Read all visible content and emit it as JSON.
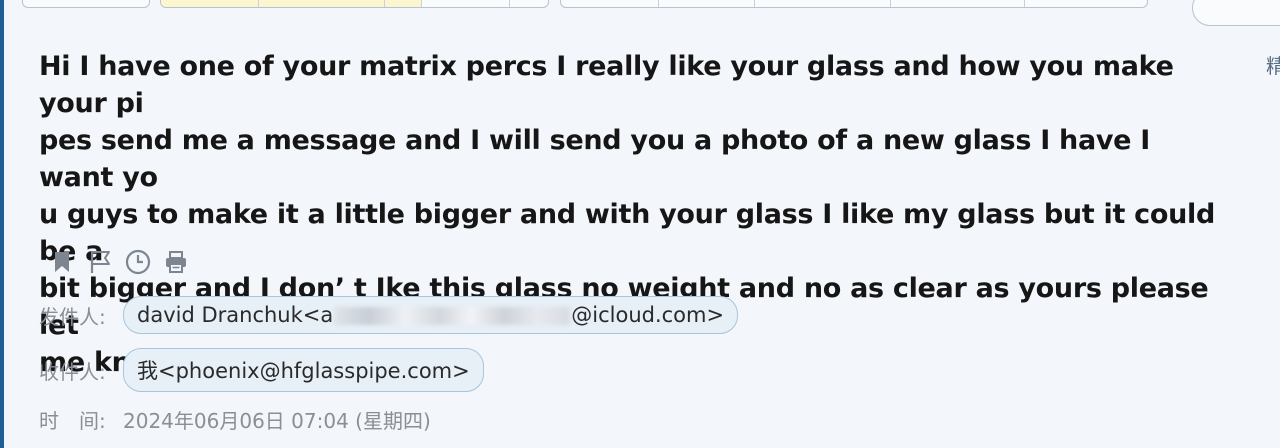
{
  "subject": "Hi I have one of your matrix percs I really like your glass and how you make your pi\npes send me a message and I will send you a photo of a new glass I have I want yo\nu guys to make it a little bigger and with your glass I like my glass but it could be a\nbit bigger and I don’ t Ike this glass no weight and no as clear as yours please let\nme know thank you",
  "side_glyph": "精",
  "actions": [
    {
      "name": "bookmark-icon"
    },
    {
      "name": "flag-icon"
    },
    {
      "name": "clock-icon"
    },
    {
      "name": "print-icon"
    }
  ],
  "sender": {
    "label": "发件人:",
    "name": "david Dranchuk<a",
    "domain": "@icloud.com>"
  },
  "recipient": {
    "label": "收件人:",
    "value": "我<phoenix@hfglasspipe.com>"
  },
  "time": {
    "label": "时　间:",
    "value": "2024年06月06日 07:04 (星期四)"
  },
  "colors": {
    "background": "#f3f6fa",
    "pill_border": "#a9c4dc",
    "pill_fill": "#e7eff7",
    "label_gray": "#8a8f96",
    "icon_gray": "#7d8590"
  }
}
